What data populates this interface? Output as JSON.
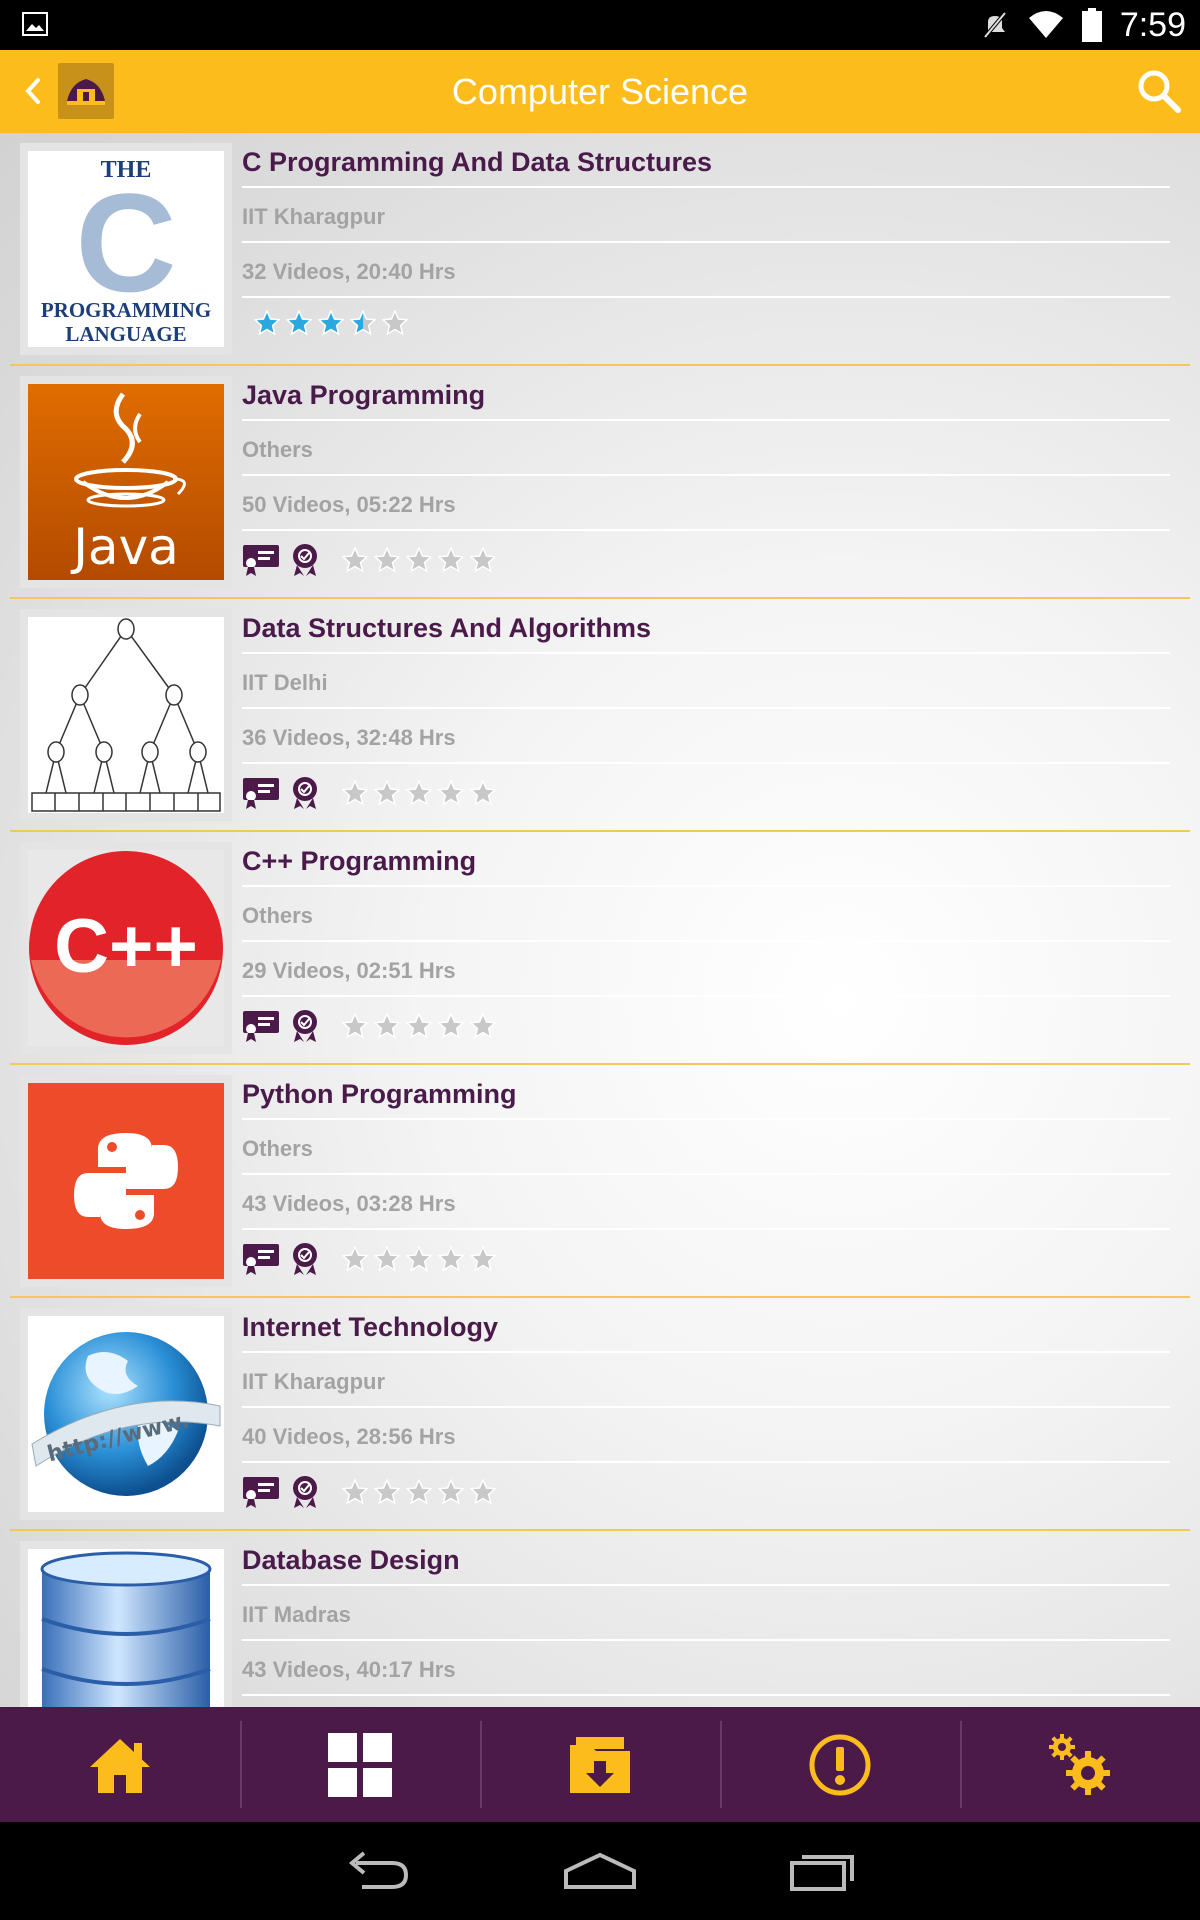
{
  "status_bar": {
    "time": "7:59",
    "icons": [
      "image-icon",
      "mute-icon",
      "wifi-icon",
      "battery-icon"
    ]
  },
  "header": {
    "title": "Computer Science",
    "back_icon": "chevron-left-icon",
    "logo_icon": "home-logo-icon",
    "search_icon": "search-icon"
  },
  "colors": {
    "header": "#fcbd1c",
    "nav": "#4b1a48",
    "title_text": "#4a1b4a",
    "sub_text": "#a3a3a3",
    "divider": "#f2c85a",
    "star_active": "#2aa9e0",
    "star_inactive": "#c8c8c8"
  },
  "courses": [
    {
      "title": "C Programming And Data Structures",
      "institute": "IIT Kharagpur",
      "stats": "32 Videos, 20:40 Hrs",
      "rating": 3.5,
      "badges": false,
      "thumb": {
        "line1": "THE",
        "line2": "C",
        "line3": "PROGRAMMING",
        "line4": "LANGUAGE"
      }
    },
    {
      "title": "Java Programming",
      "institute": "Others",
      "stats": "50 Videos, 05:22 Hrs",
      "rating": 0,
      "badges": true,
      "thumb": {
        "label": "Java"
      }
    },
    {
      "title": "Data Structures And Algorithms",
      "institute": "IIT Delhi",
      "stats": "36 Videos, 32:48 Hrs",
      "rating": 0,
      "badges": true,
      "thumb": {}
    },
    {
      "title": "C++ Programming",
      "institute": "Others",
      "stats": "29 Videos, 02:51 Hrs",
      "rating": 0,
      "badges": true,
      "thumb": {
        "label": "C++"
      }
    },
    {
      "title": "Python Programming",
      "institute": "Others",
      "stats": "43 Videos, 03:28 Hrs",
      "rating": 0,
      "badges": true,
      "thumb": {}
    },
    {
      "title": "Internet Technology",
      "institute": "IIT Kharagpur",
      "stats": "40 Videos, 28:56 Hrs",
      "rating": 0,
      "badges": true,
      "thumb": {
        "label": "http://www."
      }
    },
    {
      "title": "Database Design",
      "institute": "IIT Madras",
      "stats": "43 Videos, 40:17 Hrs",
      "rating": 0,
      "badges": true,
      "thumb": {}
    }
  ],
  "bottom_nav": [
    {
      "name": "home",
      "icon": "home-icon"
    },
    {
      "name": "categories",
      "icon": "grid-icon"
    },
    {
      "name": "downloads",
      "icon": "download-folder-icon"
    },
    {
      "name": "about",
      "icon": "alert-icon"
    },
    {
      "name": "settings",
      "icon": "gears-icon"
    }
  ],
  "system_nav": [
    "back-icon",
    "home-outline-icon",
    "recents-icon"
  ]
}
